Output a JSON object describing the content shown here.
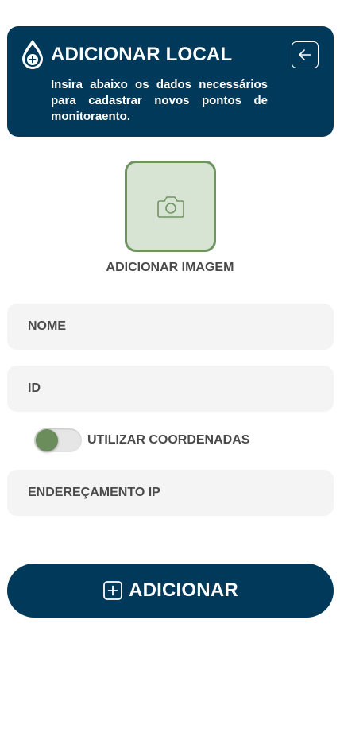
{
  "header": {
    "title": "ADICIONAR LOCAL",
    "subtitle": "Insira abaixo os dados necessários para cadastrar novos pontos de monitoraento.",
    "icon": "water-drop-plus-icon",
    "back_icon": "arrow-left-icon"
  },
  "image_picker": {
    "icon": "camera-icon",
    "label": "ADICIONAR IMAGEM"
  },
  "fields": {
    "nome": "NOME",
    "id": "ID",
    "ip": "ENDEREÇAMENTO IP"
  },
  "toggle": {
    "label": "UTILIZAR COORDENADAS",
    "on": false
  },
  "submit": {
    "label": "ADICIONAR",
    "icon": "plus-square-icon"
  },
  "colors": {
    "primary": "#00395a",
    "accent_green": "#6b8c5b",
    "image_bg": "#d8e4d3",
    "field_bg": "#f4f4f4"
  }
}
